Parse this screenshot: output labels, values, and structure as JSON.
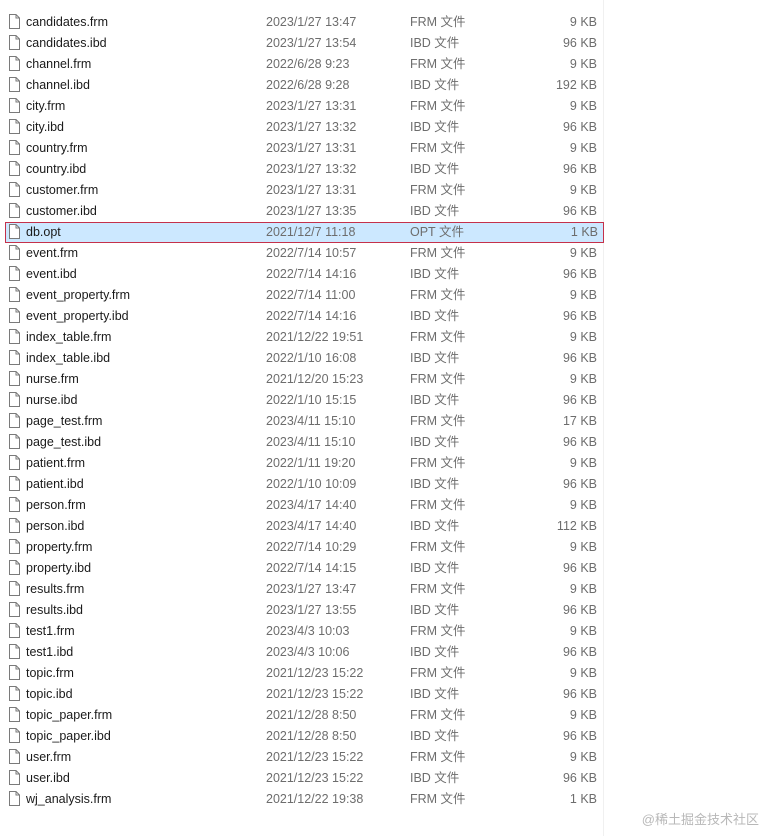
{
  "files": [
    {
      "name": "candidates.frm",
      "date": "2023/1/27 13:47",
      "type": "FRM 文件",
      "size": "9 KB"
    },
    {
      "name": "candidates.ibd",
      "date": "2023/1/27 13:54",
      "type": "IBD 文件",
      "size": "96 KB"
    },
    {
      "name": "channel.frm",
      "date": "2022/6/28 9:23",
      "type": "FRM 文件",
      "size": "9 KB"
    },
    {
      "name": "channel.ibd",
      "date": "2022/6/28 9:28",
      "type": "IBD 文件",
      "size": "192 KB"
    },
    {
      "name": "city.frm",
      "date": "2023/1/27 13:31",
      "type": "FRM 文件",
      "size": "9 KB"
    },
    {
      "name": "city.ibd",
      "date": "2023/1/27 13:32",
      "type": "IBD 文件",
      "size": "96 KB"
    },
    {
      "name": "country.frm",
      "date": "2023/1/27 13:31",
      "type": "FRM 文件",
      "size": "9 KB"
    },
    {
      "name": "country.ibd",
      "date": "2023/1/27 13:32",
      "type": "IBD 文件",
      "size": "96 KB"
    },
    {
      "name": "customer.frm",
      "date": "2023/1/27 13:31",
      "type": "FRM 文件",
      "size": "9 KB"
    },
    {
      "name": "customer.ibd",
      "date": "2023/1/27 13:35",
      "type": "IBD 文件",
      "size": "96 KB"
    },
    {
      "name": "db.opt",
      "date": "2021/12/7 11:18",
      "type": "OPT 文件",
      "size": "1 KB",
      "selected": true
    },
    {
      "name": "event.frm",
      "date": "2022/7/14 10:57",
      "type": "FRM 文件",
      "size": "9 KB"
    },
    {
      "name": "event.ibd",
      "date": "2022/7/14 14:16",
      "type": "IBD 文件",
      "size": "96 KB"
    },
    {
      "name": "event_property.frm",
      "date": "2022/7/14 11:00",
      "type": "FRM 文件",
      "size": "9 KB"
    },
    {
      "name": "event_property.ibd",
      "date": "2022/7/14 14:16",
      "type": "IBD 文件",
      "size": "96 KB"
    },
    {
      "name": "index_table.frm",
      "date": "2021/12/22 19:51",
      "type": "FRM 文件",
      "size": "9 KB"
    },
    {
      "name": "index_table.ibd",
      "date": "2022/1/10 16:08",
      "type": "IBD 文件",
      "size": "96 KB"
    },
    {
      "name": "nurse.frm",
      "date": "2021/12/20 15:23",
      "type": "FRM 文件",
      "size": "9 KB"
    },
    {
      "name": "nurse.ibd",
      "date": "2022/1/10 15:15",
      "type": "IBD 文件",
      "size": "96 KB"
    },
    {
      "name": "page_test.frm",
      "date": "2023/4/11 15:10",
      "type": "FRM 文件",
      "size": "17 KB"
    },
    {
      "name": "page_test.ibd",
      "date": "2023/4/11 15:10",
      "type": "IBD 文件",
      "size": "96 KB"
    },
    {
      "name": "patient.frm",
      "date": "2022/1/11 19:20",
      "type": "FRM 文件",
      "size": "9 KB"
    },
    {
      "name": "patient.ibd",
      "date": "2022/1/10 10:09",
      "type": "IBD 文件",
      "size": "96 KB"
    },
    {
      "name": "person.frm",
      "date": "2023/4/17 14:40",
      "type": "FRM 文件",
      "size": "9 KB"
    },
    {
      "name": "person.ibd",
      "date": "2023/4/17 14:40",
      "type": "IBD 文件",
      "size": "112 KB"
    },
    {
      "name": "property.frm",
      "date": "2022/7/14 10:29",
      "type": "FRM 文件",
      "size": "9 KB"
    },
    {
      "name": "property.ibd",
      "date": "2022/7/14 14:15",
      "type": "IBD 文件",
      "size": "96 KB"
    },
    {
      "name": "results.frm",
      "date": "2023/1/27 13:47",
      "type": "FRM 文件",
      "size": "9 KB"
    },
    {
      "name": "results.ibd",
      "date": "2023/1/27 13:55",
      "type": "IBD 文件",
      "size": "96 KB"
    },
    {
      "name": "test1.frm",
      "date": "2023/4/3 10:03",
      "type": "FRM 文件",
      "size": "9 KB"
    },
    {
      "name": "test1.ibd",
      "date": "2023/4/3 10:06",
      "type": "IBD 文件",
      "size": "96 KB"
    },
    {
      "name": "topic.frm",
      "date": "2021/12/23 15:22",
      "type": "FRM 文件",
      "size": "9 KB"
    },
    {
      "name": "topic.ibd",
      "date": "2021/12/23 15:22",
      "type": "IBD 文件",
      "size": "96 KB"
    },
    {
      "name": "topic_paper.frm",
      "date": "2021/12/28 8:50",
      "type": "FRM 文件",
      "size": "9 KB"
    },
    {
      "name": "topic_paper.ibd",
      "date": "2021/12/28 8:50",
      "type": "IBD 文件",
      "size": "96 KB"
    },
    {
      "name": "user.frm",
      "date": "2021/12/23 15:22",
      "type": "FRM 文件",
      "size": "9 KB"
    },
    {
      "name": "user.ibd",
      "date": "2021/12/23 15:22",
      "type": "IBD 文件",
      "size": "96 KB"
    },
    {
      "name": "wj_analysis.frm",
      "date": "2021/12/22 19:38",
      "type": "FRM 文件",
      "size": "1 KB"
    }
  ],
  "icons": {
    "file": "file-icon"
  },
  "colors": {
    "selection_bg": "#cce8ff",
    "selection_border": "#c4314b"
  },
  "watermark": "@稀土掘金技术社区"
}
